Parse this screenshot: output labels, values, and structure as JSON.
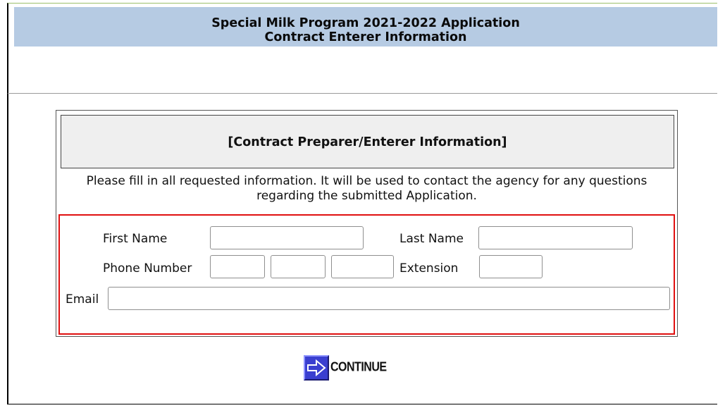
{
  "header": {
    "title_line1": "Special Milk Program 2021-2022 Application",
    "title_line2": "Contract Enterer Information"
  },
  "panel": {
    "title": "[Contract Preparer/Enterer Information]",
    "instructions": "Please fill in all requested information. It will be used to contact the agency for any questions regarding the submitted Application."
  },
  "form": {
    "first_name": {
      "label": "First Name",
      "value": ""
    },
    "last_name": {
      "label": "Last Name",
      "value": ""
    },
    "phone_number": {
      "label": "Phone Number",
      "area": "",
      "prefix": "",
      "line": ""
    },
    "extension": {
      "label": "Extension",
      "value": ""
    },
    "email": {
      "label": "Email",
      "value": ""
    }
  },
  "actions": {
    "continue_label": "CONTINUE",
    "continue_icon": "arrow-right-icon"
  },
  "colors": {
    "header_bg": "#b6cbe3",
    "highlight_border": "#e01010",
    "continue_icon_bg": "#3a3fd0"
  }
}
